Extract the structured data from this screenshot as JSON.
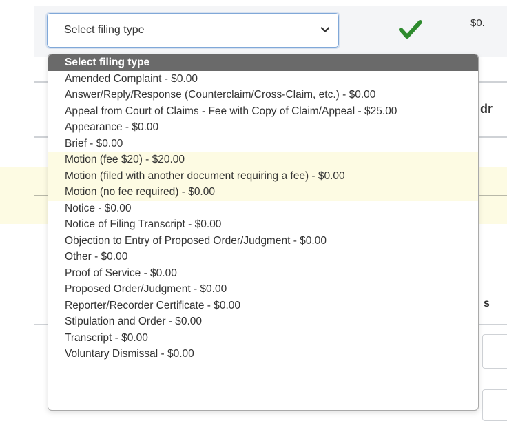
{
  "filing_select": {
    "value": "Select filing type",
    "options": [
      {
        "label": "Select filing type"
      },
      {
        "label": "Amended Complaint - $0.00"
      },
      {
        "label": "Answer/Reply/Response (Counterclaim/Cross-Claim, etc.) - $0.00"
      },
      {
        "label": "Appeal from Court of Claims - Fee with Copy of Claim/Appeal - $25.00"
      },
      {
        "label": "Appearance - $0.00"
      },
      {
        "label": "Brief - $0.00"
      },
      {
        "label": "Motion (fee $20) - $20.00"
      },
      {
        "label": "Motion (filed with another document requiring a fee) - $0.00"
      },
      {
        "label": "Motion (no fee required) - $0.00"
      },
      {
        "label": "Notice - $0.00"
      },
      {
        "label": "Notice of Filing Transcript - $0.00"
      },
      {
        "label": "Objection to Entry of Proposed Order/Judgment - $0.00"
      },
      {
        "label": "Other - $0.00"
      },
      {
        "label": "Proof of Service - $0.00"
      },
      {
        "label": "Proposed Order/Judgment - $0.00"
      },
      {
        "label": "Reporter/Recorder Certificate - $0.00"
      },
      {
        "label": "Stipulation and Order - $0.00"
      },
      {
        "label": "Transcript - $0.00"
      },
      {
        "label": "Voluntary Dismissal - $0.00"
      }
    ]
  },
  "fee_display": "$0.",
  "partial_text": {
    "right_heading": "dr",
    "right_bold": "s"
  },
  "colors": {
    "selected_option_bg": "#6a6a6a",
    "highlight_bg": "#fdfbe3",
    "check": "#2e8b2e",
    "select_border": "#80a8d8"
  },
  "icons": {
    "status": "checkmark-icon",
    "select_caret": "chevron-down-icon"
  }
}
